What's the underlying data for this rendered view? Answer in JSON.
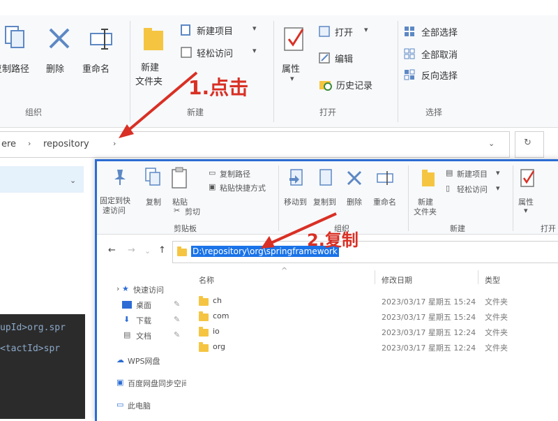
{
  "back_window": {
    "ribbon": {
      "copy_path_label": "复制路径",
      "delete_label": "删除",
      "rename_label": "重命名",
      "new_folder_label": "新建\n文件夹",
      "new_item_label": "新建项目",
      "easy_access_label": "轻松访问",
      "properties_label": "属性",
      "open_label": "打开",
      "edit_label": "编辑",
      "history_label": "历史记录",
      "select_all_label": "全部选择",
      "select_none_label": "全部取消",
      "invert_selection_label": "反向选择",
      "group_organize": "组织",
      "group_new": "新建",
      "group_open": "打开",
      "group_select": "选择"
    },
    "address": {
      "crumb_1": "ere",
      "crumb_2": "repository"
    },
    "code_lines": [
      "upId>org.spr",
      "<tactId>spr"
    ]
  },
  "annotations": {
    "step1": "1.点击",
    "step2": "2.复制"
  },
  "front_window": {
    "ribbon": {
      "pin_label": "固定到快速访问",
      "copy_label": "复制",
      "paste_label": "粘贴",
      "cut_label": "剪切",
      "copy_path_label": "复制路径",
      "paste_shortcut_label": "粘贴快捷方式",
      "move_to_label": "移动到",
      "copy_to_label": "复制到",
      "delete_label": "删除",
      "rename_label": "重命名",
      "new_folder_label": "新建\n文件夹",
      "new_item_label": "新建项目",
      "easy_access_label": "轻松访问",
      "properties_label": "属性",
      "group_clipboard": "剪贴板",
      "group_organize": "组织",
      "group_new": "新建",
      "group_open": "打开"
    },
    "address_path": "D:\\repository\\org\\springframework",
    "columns": {
      "name": "名称",
      "date": "修改日期",
      "type": "类型"
    },
    "nav": [
      {
        "label": "快速访问"
      },
      {
        "label": "桌面"
      },
      {
        "label": "下载"
      },
      {
        "label": "文档"
      },
      {
        "label": "WPS网盘"
      },
      {
        "label": "百度网盘同步空间"
      },
      {
        "label": "此电脑"
      }
    ],
    "files": [
      {
        "name": "ch",
        "date": "2023/03/17 星期五 15:24",
        "type": "文件夹"
      },
      {
        "name": "com",
        "date": "2023/03/17 星期五 15:24",
        "type": "文件夹"
      },
      {
        "name": "io",
        "date": "2023/03/17 星期五 12:24",
        "type": "文件夹"
      },
      {
        "name": "org",
        "date": "2023/03/17 星期五 12:24",
        "type": "文件夹"
      }
    ]
  },
  "colors": {
    "accent_red": "#d93025",
    "selection_blue": "#1a73e8",
    "folder_yellow": "#f5c542",
    "ribbon_bg": "#f7f9fb",
    "code_bg": "#2b2b2b"
  }
}
